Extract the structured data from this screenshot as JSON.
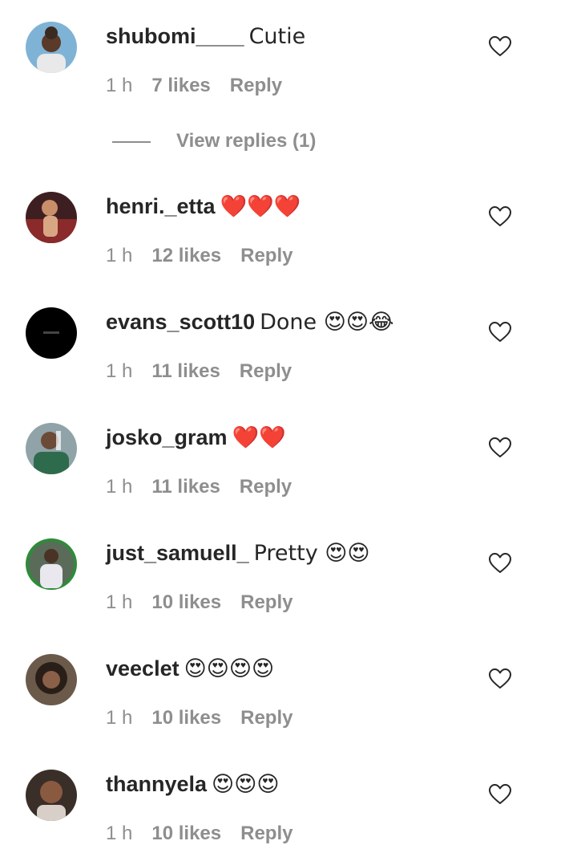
{
  "comments": [
    {
      "username": "shubomi____",
      "text": "Cutie",
      "time": "1 h",
      "likes": "7 likes",
      "reply": "Reply",
      "avatar": "avatar-1"
    },
    {
      "username": "henri._etta",
      "text": "❤️❤️❤️",
      "time": "1 h",
      "likes": "12 likes",
      "reply": "Reply",
      "avatar": "avatar-2"
    },
    {
      "username": "evans_scott10",
      "text": "Done 😍😍😂",
      "time": "1 h",
      "likes": "11 likes",
      "reply": "Reply",
      "avatar": "avatar-3"
    },
    {
      "username": "josko_gram",
      "text": "❤️❤️",
      "time": "1 h",
      "likes": "11 likes",
      "reply": "Reply",
      "avatar": "avatar-4"
    },
    {
      "username": "just_samuell_",
      "text": "Pretty 😍😍",
      "time": "1 h",
      "likes": "10 likes",
      "reply": "Reply",
      "avatar": "avatar-5"
    },
    {
      "username": "veeclet",
      "text": "😍😍😍😍",
      "time": "1 h",
      "likes": "10 likes",
      "reply": "Reply",
      "avatar": "avatar-6"
    },
    {
      "username": "thannyela",
      "text": "😍😍😍",
      "time": "1 h",
      "likes": "10 likes",
      "reply": "Reply",
      "avatar": "avatar-7"
    }
  ],
  "view_replies": "View replies (1)",
  "colors": {
    "text": "#262626",
    "muted": "#8e8e8e",
    "background": "#ffffff"
  },
  "icons": {
    "like": "heart-outline-icon"
  }
}
